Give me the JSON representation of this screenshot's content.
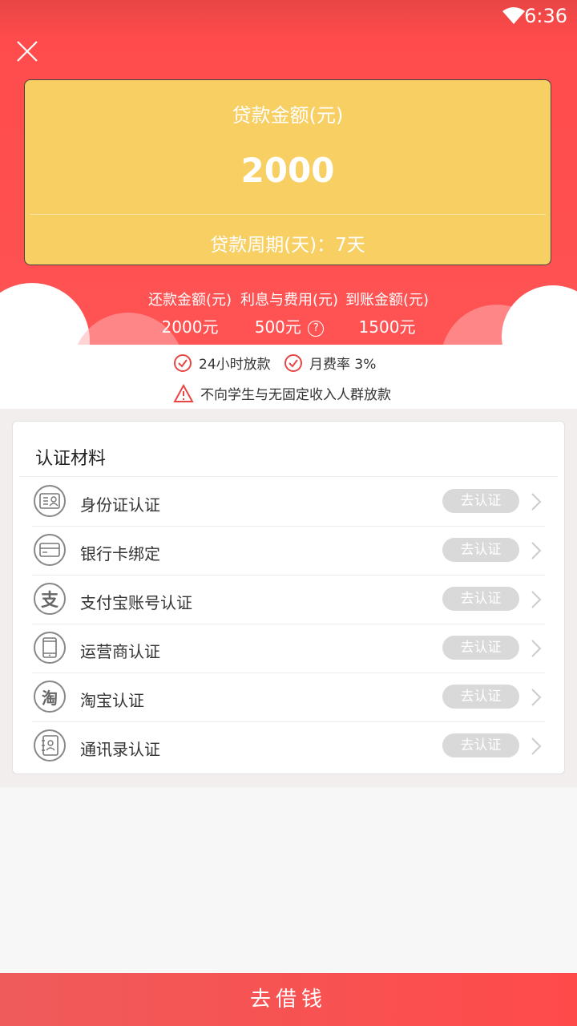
{
  "status": {
    "time": "6:36"
  },
  "card": {
    "label": "贷款金额(元)",
    "amount": "2000",
    "period": "贷款周期(天)：7天"
  },
  "summary": [
    {
      "label": "还款金额(元)",
      "value": "2000元"
    },
    {
      "label": "利息与费用(元)",
      "value": "500元"
    },
    {
      "label": "到账金额(元)",
      "value": "1500元"
    }
  ],
  "help_glyph": "?",
  "features": {
    "f1": "24小时放款",
    "f2": "月费率 3%",
    "warning": "不向学生与无固定收入人群放款"
  },
  "panel": {
    "title": "认证材料",
    "items": [
      {
        "name": "身份证认证",
        "action": "去认证",
        "icon": "id-card-icon"
      },
      {
        "name": "银行卡绑定",
        "action": "去认证",
        "icon": "bank-card-icon"
      },
      {
        "name": "支付宝账号认证",
        "action": "去认证",
        "icon": "alipay-icon",
        "glyph": "支"
      },
      {
        "name": "运营商认证",
        "action": "去认证",
        "icon": "phone-icon"
      },
      {
        "name": "淘宝认证",
        "action": "去认证",
        "icon": "taobao-icon",
        "glyph": "淘"
      },
      {
        "name": "通讯录认证",
        "action": "去认证",
        "icon": "contacts-icon"
      }
    ]
  },
  "bottom_button": "去借钱",
  "colors": {
    "accent": "#ff4b4b",
    "card": "#f7cf63",
    "button_disabled": "#d9d9d9"
  }
}
